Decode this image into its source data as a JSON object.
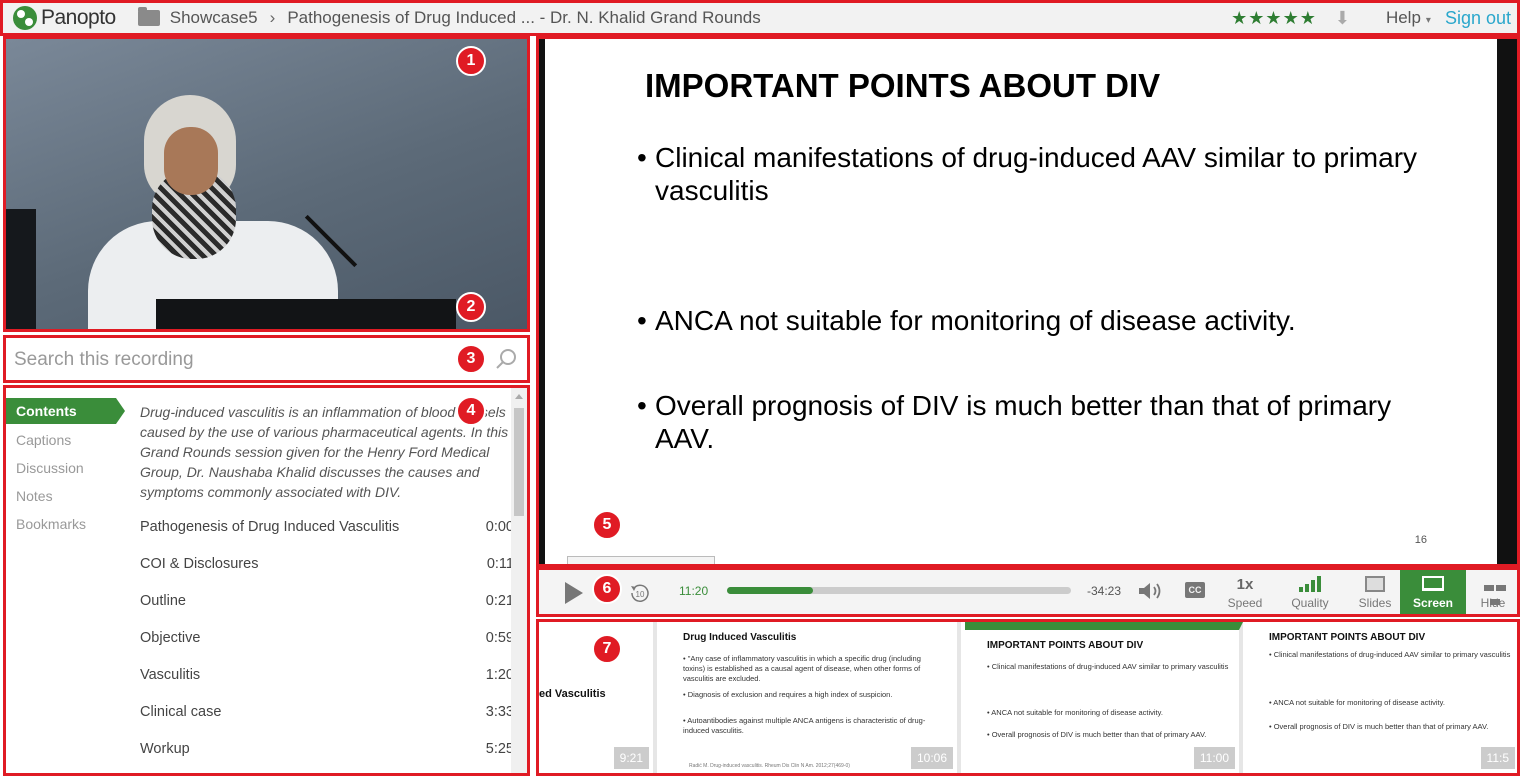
{
  "topbar": {
    "logo_text": "Panopto",
    "folder": "Showcase5",
    "title": "Pathogenesis of Drug Induced ... - Dr. N. Khalid Grand Rounds",
    "rating": "★★★★★",
    "help": "Help",
    "sign_out": "Sign out"
  },
  "badges": [
    "1",
    "2",
    "3",
    "4",
    "5",
    "6",
    "7"
  ],
  "search": {
    "placeholder": "Search this recording"
  },
  "nav": {
    "items": [
      {
        "label": "Contents",
        "active": true
      },
      {
        "label": "Captions"
      },
      {
        "label": "Discussion"
      },
      {
        "label": "Notes"
      },
      {
        "label": "Bookmarks"
      }
    ]
  },
  "description": "Drug-induced vasculitis is an inflammation of blood vessels caused by the use of various pharmaceutical agents. In this Grand Rounds session given for the Henry Ford Medical Group, Dr. Naushaba Khalid discusses the causes and symptoms commonly associated with DIV.",
  "toc": [
    {
      "title": "Pathogenesis of Drug Induced Vasculitis",
      "time": "0:00"
    },
    {
      "title": "COI & Disclosures",
      "time": "0:11"
    },
    {
      "title": "Outline",
      "time": "0:21"
    },
    {
      "title": "Objective",
      "time": "0:59"
    },
    {
      "title": "Vasculitis",
      "time": "1:20"
    },
    {
      "title": "Clinical case",
      "time": "3:33"
    },
    {
      "title": "Workup",
      "time": "5:25"
    }
  ],
  "slide": {
    "title": "IMPORTANT POINTS ABOUT DIV",
    "bullets": [
      "Clinical manifestations of drug-induced AAV similar to primary vasculitis",
      "ANCA not suitable for monitoring of disease activity.",
      "Overall prognosis of DIV is much better than that of primary AAV."
    ],
    "page_number": "16"
  },
  "controls": {
    "elapsed": "11:20",
    "remaining": "-34:23",
    "progress": 0.25,
    "cc": "CC",
    "speed_value": "1x",
    "speed_label": "Speed",
    "quality_label": "Quality",
    "slides_label": "Slides",
    "screen_label": "Screen",
    "hide_label": "Hide"
  },
  "thumbnails": [
    {
      "title": "ed Vasculitis",
      "time": "9:21"
    },
    {
      "title": "Drug Induced Vasculitis",
      "lines": [
        "• \"Any case of inflammatory vasculitis in which a specific drug (including toxins) is established as a causal agent of disease, when other forms of vasculitis are excluded.",
        "• Diagnosis of exclusion and requires a high index of suspicion.",
        "• Autoantibodies against multiple ANCA antigens is characteristic of drug-induced vasculitis."
      ],
      "footer": "Radić M. Drug-induced vasculitis. Rheum Dis Clin N Am. 2012;27(469-0)",
      "time": "10:06"
    },
    {
      "title": "IMPORTANT POINTS ABOUT DIV",
      "lines": [
        "• Clinical manifestations of drug-induced AAV similar to primary vasculitis",
        "• ANCA not suitable for monitoring of disease activity.",
        "• Overall prognosis of DIV is much better than that of primary AAV."
      ],
      "time": "11:00"
    },
    {
      "title": "IMPORTANT POINTS ABOUT DIV",
      "lines": [
        "• Clinical manifestations of drug-induced AAV similar to primary vasculitis",
        "• ANCA not suitable for monitoring of disease activity.",
        "• Overall prognosis of DIV is much better than that of primary AAV."
      ],
      "time": "11:5"
    }
  ],
  "colors": {
    "accent": "#3a8d3a",
    "annotation": "#e01b24",
    "link": "#2aa7cc"
  }
}
